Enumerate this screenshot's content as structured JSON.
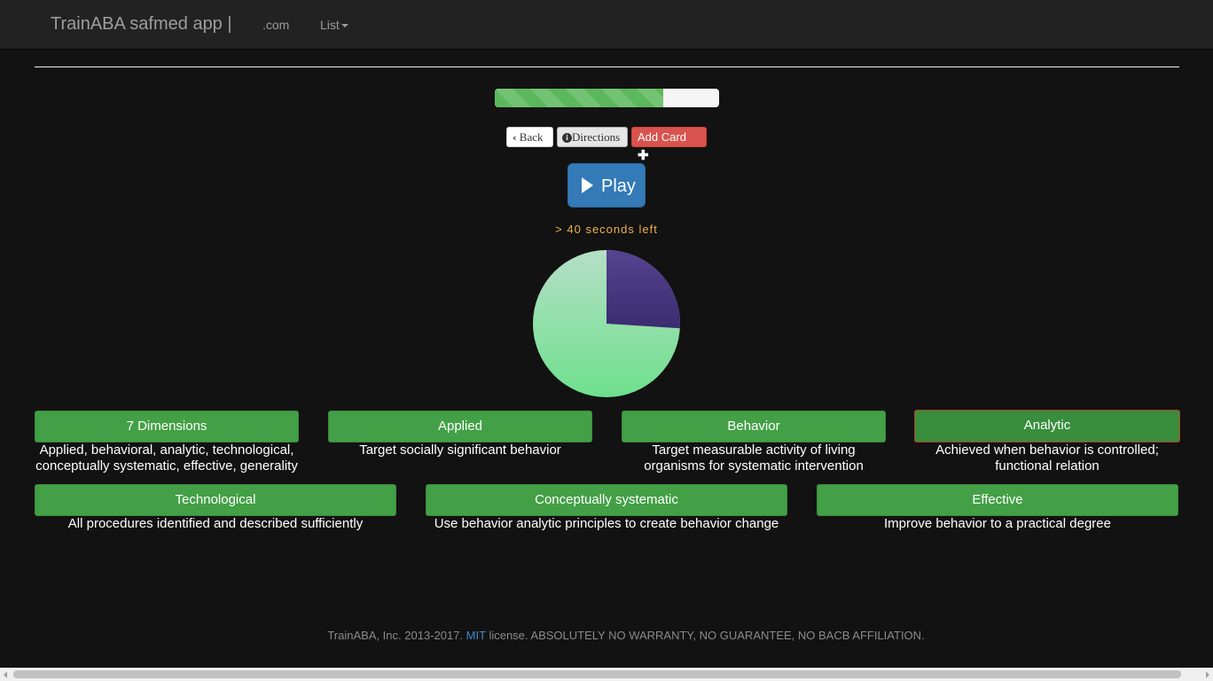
{
  "navbar": {
    "brand": "TrainABA safmed app |",
    "links": [
      ".com",
      "List"
    ]
  },
  "progress": {
    "fraction": 0.75
  },
  "toolbar": {
    "back_label": "Back",
    "directions_label": "Directions",
    "add_card_label": "Add Card"
  },
  "play": {
    "label": "Play"
  },
  "timer": {
    "text": "> 40 seconds left"
  },
  "pie": {
    "fraction_remaining": 0.26,
    "remaining_color": "#4a3a82",
    "elapsed_color": "#7ed99a"
  },
  "cards_row1": [
    {
      "title": "7 Dimensions",
      "desc": "Applied, behavioral, analytic, technological, conceptually systematic, effective, generality"
    },
    {
      "title": "Applied",
      "desc": "Target socially significant behavior"
    },
    {
      "title": "Behavior",
      "desc": "Target measurable activity of living organisms for systematic intervention"
    },
    {
      "title": "Analytic",
      "desc": "Achieved when behavior is controlled; functional relation"
    }
  ],
  "cards_row2": [
    {
      "title": "Technological",
      "desc": "All procedures identified and described sufficiently"
    },
    {
      "title": "Conceptually systematic",
      "desc": "Use behavior analytic principles to create behavior change"
    },
    {
      "title": "Effective",
      "desc": "Improve behavior to a practical degree"
    }
  ],
  "footer": {
    "prefix": "TrainABA, Inc. 2013-2017.",
    "link": "MIT",
    "suffix": "license. ABSOLUTELY NO WARRANTY, NO GUARANTEE, NO BACB AFFILIATION."
  }
}
